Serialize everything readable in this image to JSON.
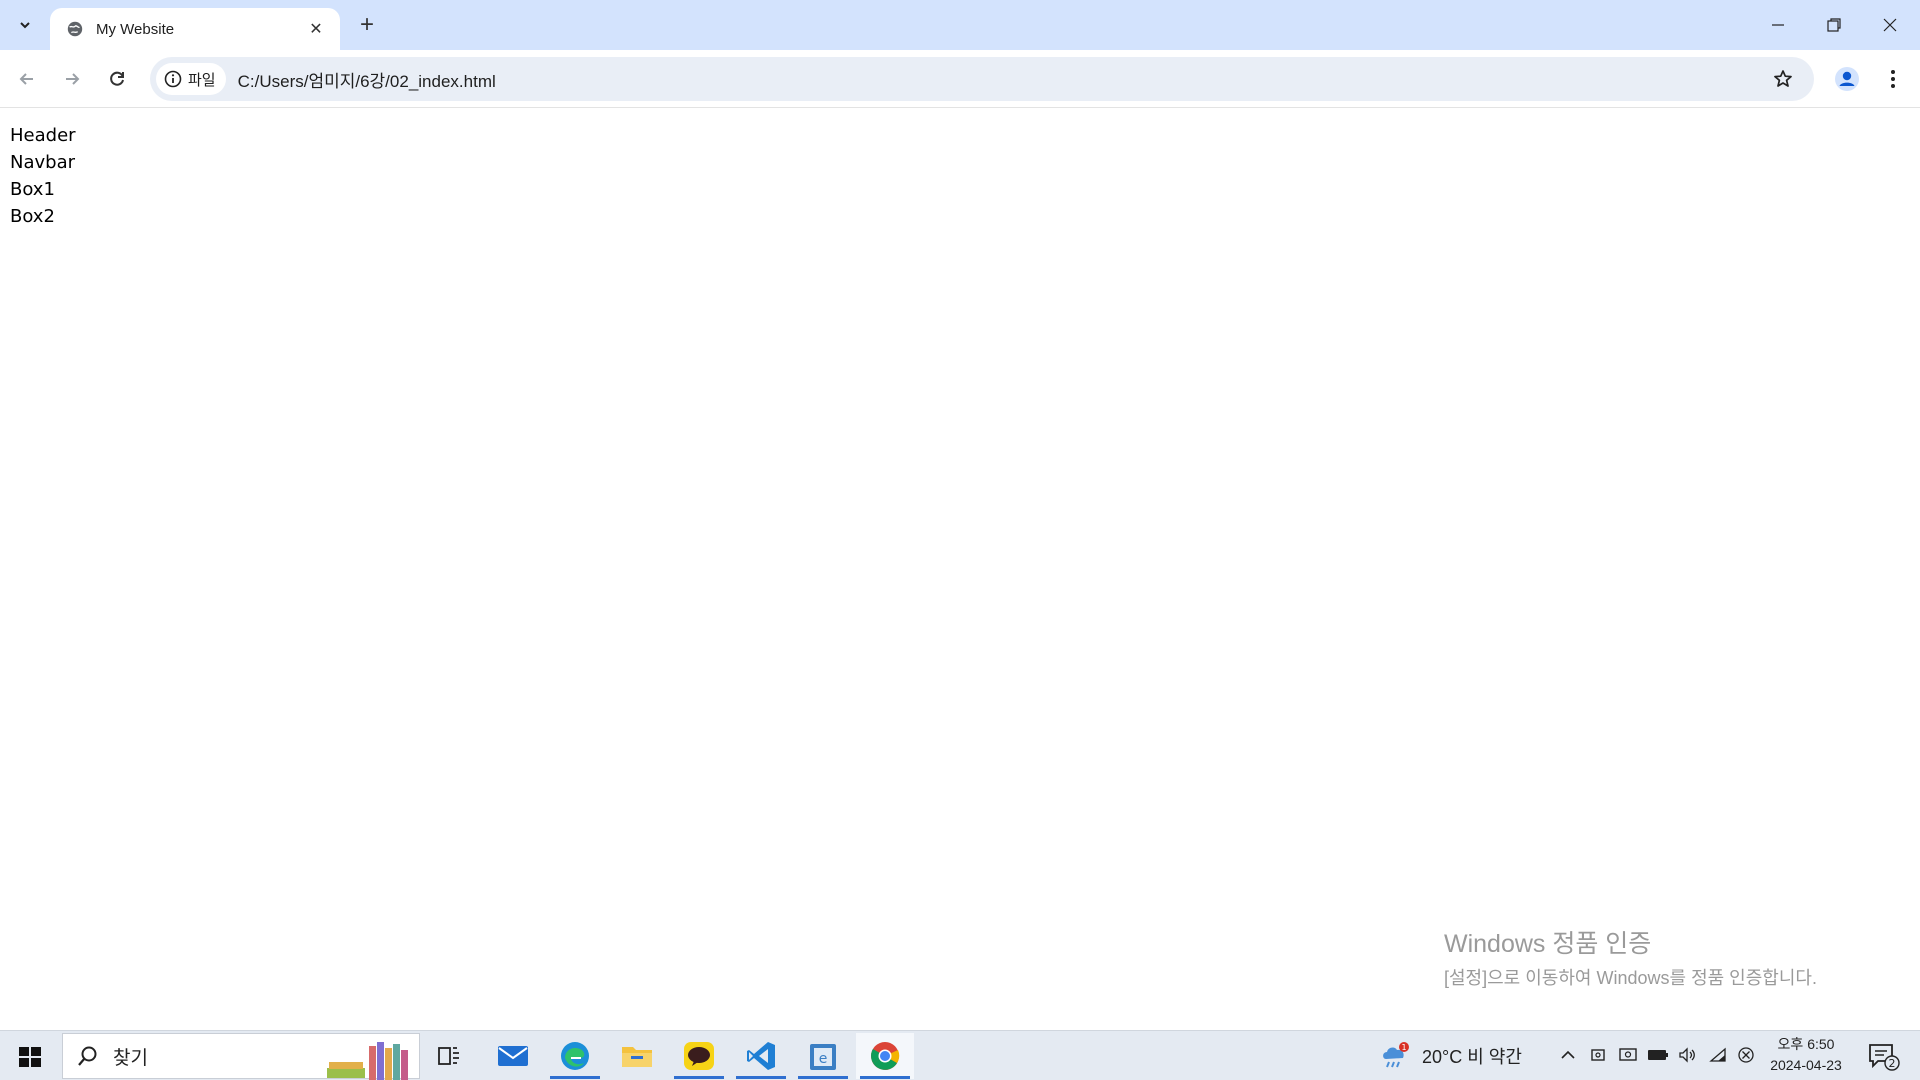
{
  "browser": {
    "tab_title": "My Website",
    "site_chip": "파일",
    "url": "C:/Users/엄미지/6강/02_index.html"
  },
  "page": {
    "lines": [
      "Header",
      "Navbar",
      "Box1",
      "Box2"
    ]
  },
  "watermark": {
    "title": "Windows 정품 인증",
    "subtitle": "[설정]으로 이동하여 Windows를 정품 인증합니다."
  },
  "taskbar": {
    "search_label": "찾기",
    "weather_badge": "1",
    "weather_text": "20°C 비 약간",
    "time": "오후 6:50",
    "date": "2024-04-23",
    "notification_count": "2",
    "apps": [
      "task-view",
      "mail",
      "edge",
      "file-explorer",
      "kakaotalk",
      "vscode",
      "notepad",
      "chrome"
    ]
  },
  "colors": {
    "tabstrip": "#d3e3fd",
    "omnibox": "#e9eef6",
    "taskbar": "#e4eaf2",
    "accent": "#2f6fd0"
  }
}
